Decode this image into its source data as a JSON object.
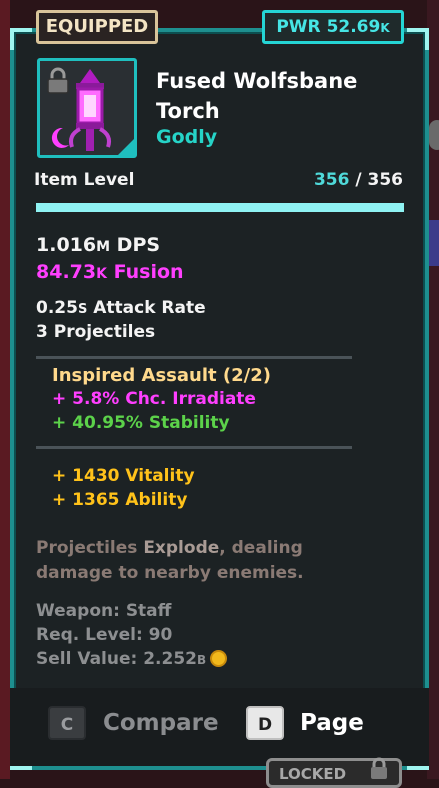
{
  "badges": {
    "equipped": "EQUIPPED",
    "power_label": "PWR",
    "power_value": "52.69",
    "power_unit": "K"
  },
  "item": {
    "name": "Fused Wolfsbane Torch",
    "rarity": "Godly",
    "icon": "torch-icon"
  },
  "item_level": {
    "label": "Item Level",
    "current": "356",
    "separator": "/",
    "max": "356",
    "progress": 1.0
  },
  "stats": {
    "dps_value": "1.016",
    "dps_unit": "M",
    "dps_label": "DPS",
    "fusion_value": "84.73",
    "fusion_unit": "K",
    "fusion_label": "Fusion",
    "attack_rate_value": "0.25",
    "attack_rate_unit": "S",
    "attack_rate_label": "Attack Rate",
    "projectiles": "3 Projectiles"
  },
  "set_bonus": {
    "title": "Inspired Assault (2/2)",
    "bonus1": "+ 5.8% Chc. Irradiate",
    "bonus2": "+ 40.95% Stability"
  },
  "attributes": {
    "vitality": "+ 1430 Vitality",
    "ability": "+ 1365 Ability"
  },
  "description": {
    "part1": "Projectiles",
    "part2": "Explode",
    "part3": ", dealing damage to nearby enemies."
  },
  "meta": {
    "weapon": "Weapon: Staff",
    "req_level": "Req. Level: 90",
    "sell_label": "Sell Value: 2.252",
    "sell_unit": "B"
  },
  "actions": {
    "compare_key": "C",
    "compare_label": "Compare",
    "page_key": "D",
    "page_label": "Page"
  },
  "lock_tab": {
    "label": "LOCKED"
  },
  "colors": {
    "accent": "#1e8f8f",
    "rarity": "#26d4c8",
    "fusion": "#ff3fff",
    "stability": "#5cd24a",
    "gold": "#ffc21a"
  }
}
